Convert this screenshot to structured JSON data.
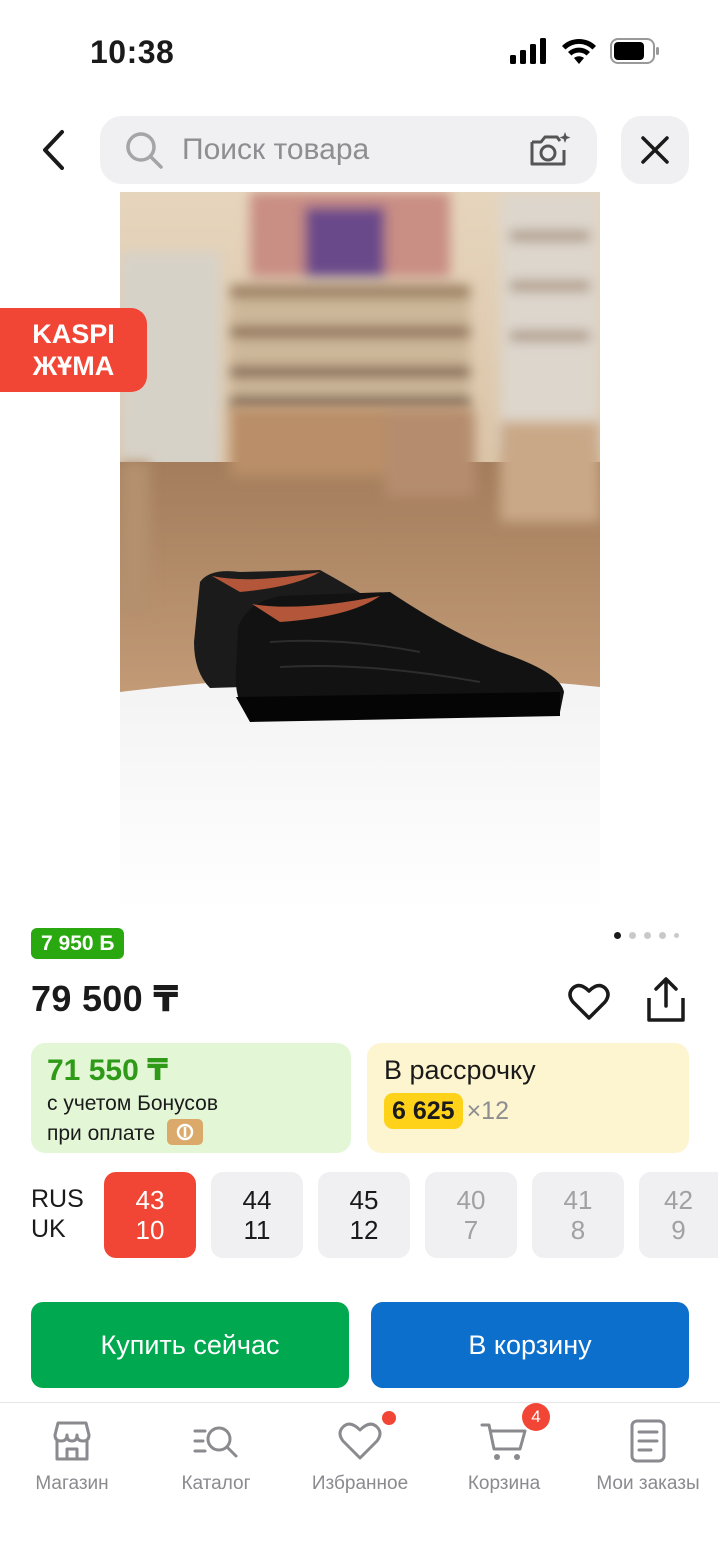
{
  "status_bar": {
    "time": "10:38"
  },
  "search": {
    "placeholder": "Поиск товара"
  },
  "promo_badge": {
    "line1": "KASPI",
    "line2": "ЖҰМА"
  },
  "gallery": {
    "total_slides": 5,
    "active_slide": 1
  },
  "product": {
    "bonus": "7 950 Б",
    "price": "79 500 ₸"
  },
  "bonus_card": {
    "amount": "71 550 ₸",
    "line1": "с учетом Бонусов",
    "line2": "при оплате"
  },
  "credit_card": {
    "title": "В рассрочку",
    "amount": "6 625",
    "months": "×12"
  },
  "sizes": {
    "label_rus": "RUS",
    "label_uk": "UK",
    "items": [
      {
        "rus": "43",
        "uk": "10",
        "state": "selected"
      },
      {
        "rus": "44",
        "uk": "11",
        "state": "available"
      },
      {
        "rus": "45",
        "uk": "12",
        "state": "available"
      },
      {
        "rus": "40",
        "uk": "7",
        "state": "unavailable"
      },
      {
        "rus": "41",
        "uk": "8",
        "state": "unavailable"
      },
      {
        "rus": "42",
        "uk": "9",
        "state": "unavailable"
      }
    ]
  },
  "actions": {
    "buy_now": "Купить сейчас",
    "add_to_cart": "В корзину"
  },
  "bottom_nav": {
    "items": [
      {
        "label": "Магазин",
        "icon": "store-icon"
      },
      {
        "label": "Каталог",
        "icon": "catalog-search-icon"
      },
      {
        "label": "Избранное",
        "icon": "heart-icon"
      },
      {
        "label": "Корзина",
        "icon": "cart-icon",
        "badge": "4"
      },
      {
        "label": "Мои заказы",
        "icon": "orders-icon"
      }
    ]
  },
  "colors": {
    "promo_red": "#f14635",
    "bonus_green": "#2aa80f",
    "buy_green": "#00a94f",
    "cart_blue": "#0b6fcb",
    "credit_yellow": "#ffd21a"
  }
}
